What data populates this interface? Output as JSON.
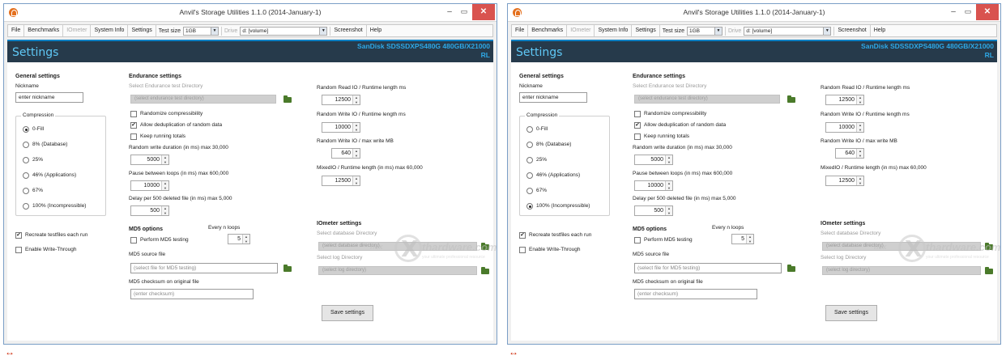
{
  "window": {
    "title": "Anvil's Storage Utilities 1.1.0 (2014-January-1)",
    "minimize": "–",
    "maximize": "▭",
    "close": "✕"
  },
  "menu": {
    "file": "File",
    "benchmarks": "Benchmarks",
    "iometer": "IOmeter",
    "system_info": "System Info",
    "settings": "Settings",
    "test_size_label": "Test size",
    "test_size_value": "1GB",
    "drive_label": "Drive",
    "drive_value": "d: [volume]",
    "screenshot": "Screenshot",
    "help": "Help"
  },
  "header": {
    "title": "Settings",
    "drive_model": "SanDisk SDSSDXPS480G 480GB/X21000RL"
  },
  "general": {
    "heading": "General settings",
    "nickname_label": "Nickname",
    "nickname_value": "enter nickname",
    "compression_label": "Compression",
    "options": [
      "0-Fill",
      "8% (Database)",
      "25%",
      "46% (Applications)",
      "67%",
      "100% (Incompressible)"
    ],
    "recreate_label": "Recreate testfiles each run",
    "recreate_checked": true,
    "write_through_label": "Enable Write-Through",
    "write_through_checked": false
  },
  "endurance": {
    "heading": "Endurance settings",
    "dir_label": "Select Endurance test Directory",
    "dir_placeholder": "(select endurance test directory)",
    "randomize_label": "Randomize compressibility",
    "randomize_checked": false,
    "dedup_label": "Allow deduplication of random data",
    "dedup_checked": true,
    "totals_label": "Keep running totals",
    "totals_checked": false,
    "random_write_label": "Random write duration (in ms) max 30,000",
    "random_write_value": "5000",
    "pause_label": "Pause between loops (in ms) max 600,000",
    "pause_value": "10000",
    "delay_label": "Delay per 500 deleted file (in ms) max 5,000",
    "delay_value": "500"
  },
  "md5": {
    "heading": "MD5 options",
    "perform_label": "Perform MD5 testing",
    "perform_checked": false,
    "every_label": "Every n loops",
    "every_value": "5",
    "source_label": "MD5 source file",
    "source_placeholder": "(select file for MD5 testing)",
    "checksum_label": "MD5 checksum on original file",
    "checksum_placeholder": "(enter checksum)"
  },
  "runtime": {
    "read_label": "Random Read IO / Runtime length ms",
    "read_value": "12500",
    "write_label": "Random Write IO / Runtime length ms",
    "write_value": "10000",
    "write_mb_label": "Random Write IO / max write MB",
    "write_mb_value": "640",
    "mixed_label": "MixedIO / Runtime length (in ms) max 60,000",
    "mixed_value": "12500"
  },
  "iometer_settings": {
    "heading": "IOmeter settings",
    "db_label": "Select database Directory",
    "db_placeholder": "(select database directory)",
    "log_label": "Select log Directory",
    "log_placeholder": "(select log directory)"
  },
  "save_button": "Save settings",
  "watermark": {
    "left": "nex",
    "brand": "thardware.com",
    "sub": "your ultimate professional resource"
  },
  "screens": [
    {
      "selected_compression": "0-Fill"
    },
    {
      "selected_compression": "100% (Incompressible)"
    }
  ],
  "arrow": "↔",
  "colors": {
    "header_bg": "#263a4b",
    "header_title": "#5fc8f6",
    "drive_model": "#2ea8e6",
    "close_button": "#d9534f"
  }
}
